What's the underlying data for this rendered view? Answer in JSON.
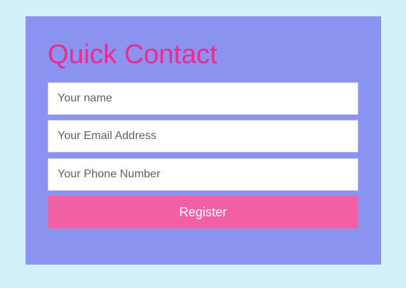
{
  "form": {
    "title": "Quick Contact",
    "name_placeholder": "Your name",
    "email_placeholder": "Your Email Address",
    "phone_placeholder": "Your Phone Number",
    "submit_label": "Register"
  },
  "colors": {
    "page_background": "#d3f1fa",
    "card_background": "#8a93f0",
    "title": "#ee2a90",
    "button": "#f25fa4",
    "button_text": "#ffffff"
  }
}
